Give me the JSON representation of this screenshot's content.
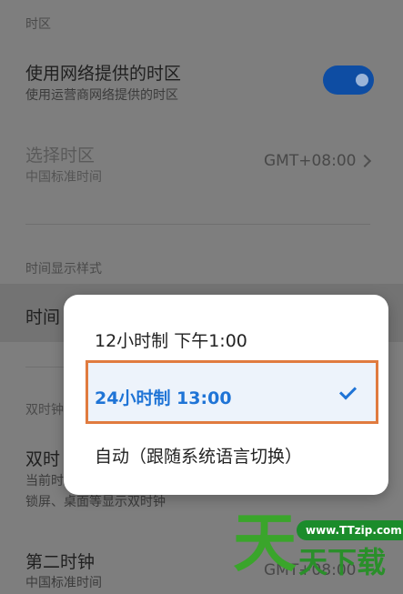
{
  "sections": {
    "timezone": "时区",
    "time_display_style": "时间显示样式",
    "dual_clock": "双时钟"
  },
  "rows": {
    "network_timezone": {
      "title": "使用网络提供的时区",
      "subtitle": "使用运营商网络提供的时区",
      "toggle_on": true
    },
    "select_timezone": {
      "title": "选择时区",
      "subtitle": "中国标准时间",
      "value": "GMT+08:00"
    },
    "time_format_row": {
      "title": "时间"
    },
    "dual_clock_row": {
      "title": "双时",
      "subtitle_line1": "当前时",
      "subtitle_line2": "锁屏、桌面等显示双时钟"
    },
    "second_clock": {
      "title": "第二时钟",
      "subtitle": "中国标准时间",
      "value": "GMT+08:00"
    }
  },
  "dialog": {
    "options": [
      {
        "label": "12小时制 下午1:00",
        "selected": false
      },
      {
        "label": "24小时制 13:00",
        "selected": true
      },
      {
        "label": "自动（跟随系统语言切换）",
        "selected": false
      }
    ]
  },
  "watermark": {
    "big_char": "天",
    "site": "www.TTzip.com",
    "name": "天下载"
  },
  "colors": {
    "accent": "#1f74d6",
    "toggle": "#0e4da3",
    "highlight_border": "#e07b3f",
    "watermark_green": "#3aa52b"
  }
}
